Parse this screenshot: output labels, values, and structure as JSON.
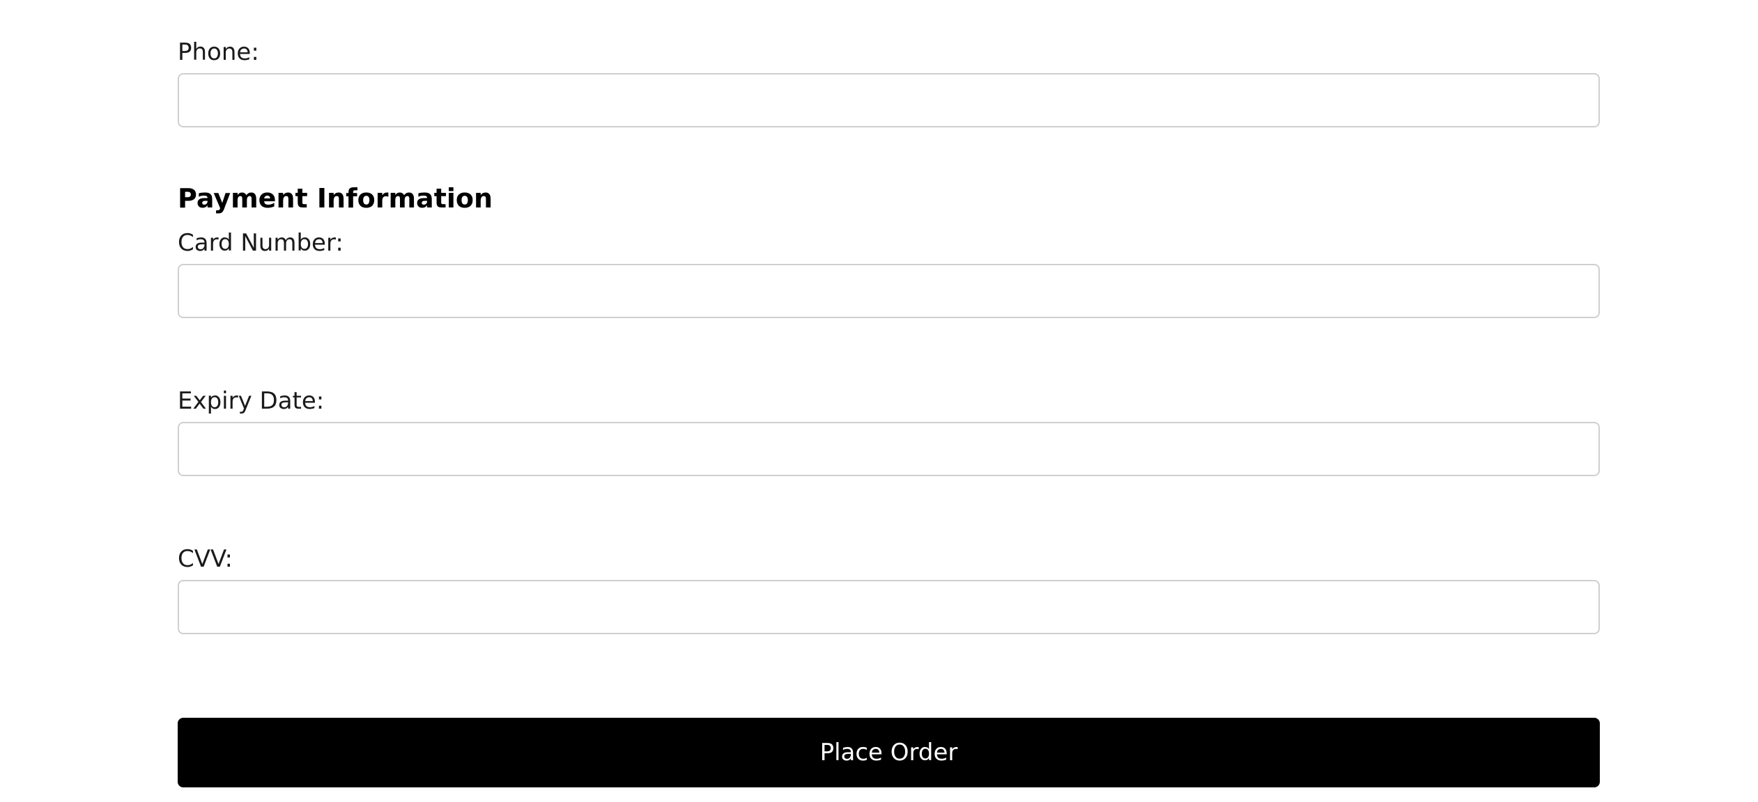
{
  "contact": {
    "phone_label": "Phone:",
    "phone_value": ""
  },
  "payment": {
    "heading": "Payment Information",
    "card_number_label": "Card Number:",
    "card_number_value": "",
    "expiry_label": "Expiry Date:",
    "expiry_value": "",
    "cvv_label": "CVV:",
    "cvv_value": ""
  },
  "actions": {
    "place_order_label": "Place Order"
  },
  "colors": {
    "button_background": "#000000",
    "button_text": "#ffffff",
    "input_border": "#cfcfcf"
  }
}
